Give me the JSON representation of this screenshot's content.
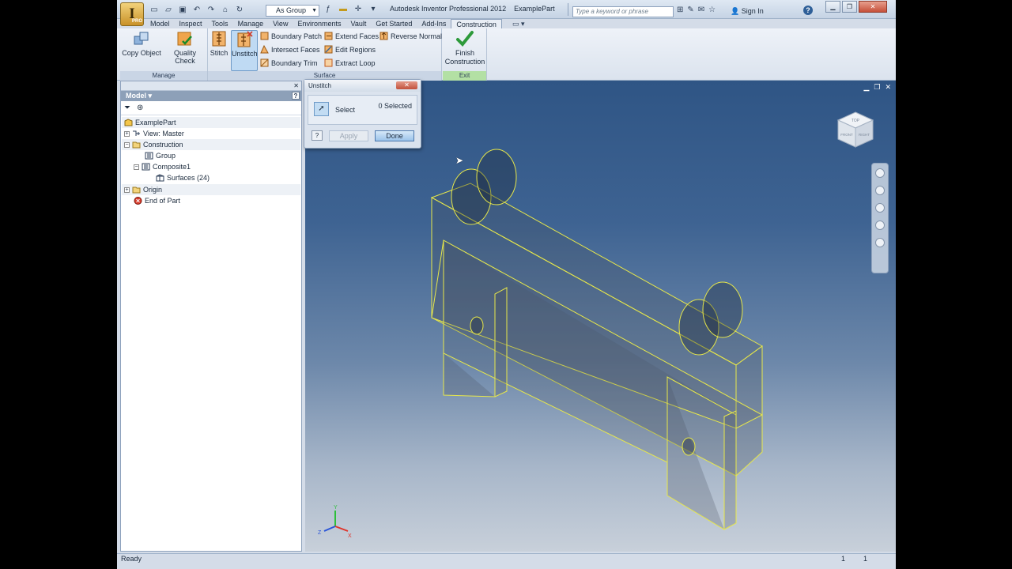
{
  "window": {
    "title": "Autodesk Inventor Professional 2012",
    "document": "ExamplePart",
    "app_button": "I",
    "app_badge": "PRO",
    "style_select": "As Group",
    "search_placeholder": "Type a keyword or phrase",
    "sign_in": "Sign In",
    "help": "?"
  },
  "tabs": [
    {
      "label": "Model"
    },
    {
      "label": "Inspect"
    },
    {
      "label": "Tools"
    },
    {
      "label": "Manage"
    },
    {
      "label": "View"
    },
    {
      "label": "Environments"
    },
    {
      "label": "Vault"
    },
    {
      "label": "Get Started"
    },
    {
      "label": "Add-Ins"
    },
    {
      "label": "Construction",
      "active": true
    }
  ],
  "ribbon": {
    "manage": {
      "title": "Manage",
      "copy_object": "Copy Object",
      "quality_check": "Quality Check"
    },
    "surface": {
      "title": "Surface",
      "stitch": "Stitch",
      "unstitch": "Unstitch",
      "boundary_patch": "Boundary Patch",
      "intersect_faces": "Intersect Faces",
      "boundary_trim": "Boundary Trim",
      "extend_faces": "Extend Faces",
      "edit_regions": "Edit Regions",
      "extract_loop": "Extract Loop",
      "reverse_normal": "Reverse Normal"
    },
    "exit": {
      "title": "Exit",
      "finish_line1": "Finish",
      "finish_line2": "Construction"
    }
  },
  "browser": {
    "header": "Model",
    "dropdown_glyph": "▾",
    "help": "?",
    "close": "✕",
    "tree": [
      {
        "label": "ExamplePart"
      },
      {
        "label": "View: Master"
      },
      {
        "label": "Construction"
      },
      {
        "label": "Group"
      },
      {
        "label": "Composite1"
      },
      {
        "label": "Surfaces (24)"
      },
      {
        "label": "Origin"
      },
      {
        "label": "End of Part"
      }
    ]
  },
  "dialog": {
    "title": "Unstitch",
    "select_label": "Select",
    "selected_count": "0 Selected",
    "help": "?",
    "apply": "Apply",
    "done": "Done"
  },
  "viewcube": {
    "top": "TOP",
    "front": "FRONT",
    "right": "RIGHT"
  },
  "triad": {
    "x": "X",
    "y": "Y",
    "z": "Z"
  },
  "status": {
    "text": "Ready",
    "n1": "1",
    "n2": "1"
  },
  "colors": {
    "edge": "#e8e84a",
    "viewport_top": "#2f5585",
    "accent": "#6f9bc8"
  }
}
